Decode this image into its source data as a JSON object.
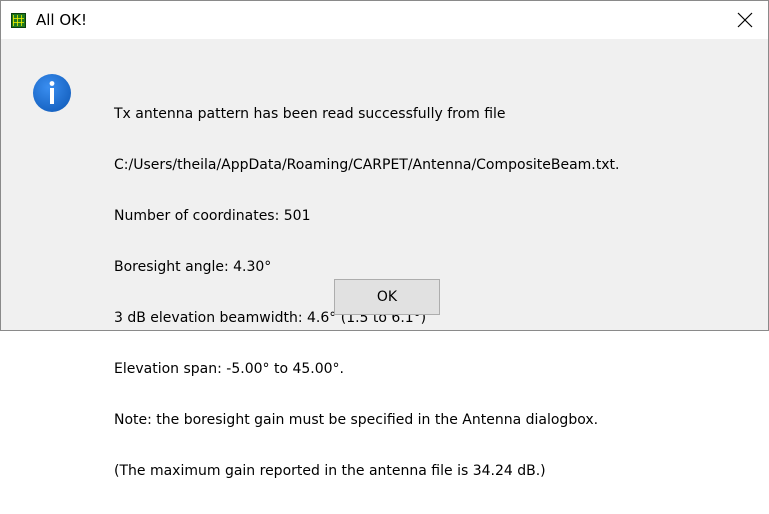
{
  "window": {
    "title": "All OK!",
    "app_icon": "grid-app-icon",
    "close_icon": "close-icon"
  },
  "dialog": {
    "icon": "info-icon",
    "message_lines": [
      "Tx antenna pattern has been read successfully from file",
      "C:/Users/theila/AppData/Roaming/CARPET/Antenna/CompositeBeam.txt.",
      "Number of coordinates: 501",
      "Boresight angle: 4.30°",
      "3 dB elevation beamwidth: 4.6° (1.5 to 6.1°)",
      "Elevation span: -5.00° to 45.00°.",
      "Note: the boresight gain must be specified in the Antenna dialogbox.",
      "(The maximum gain reported in the antenna file is 34.24 dB.)"
    ],
    "ok_label": "OK"
  },
  "colors": {
    "info_blue": "#1a6fd0",
    "dialog_bg": "#f0f0f0",
    "titlebar_bg": "#ffffff"
  }
}
